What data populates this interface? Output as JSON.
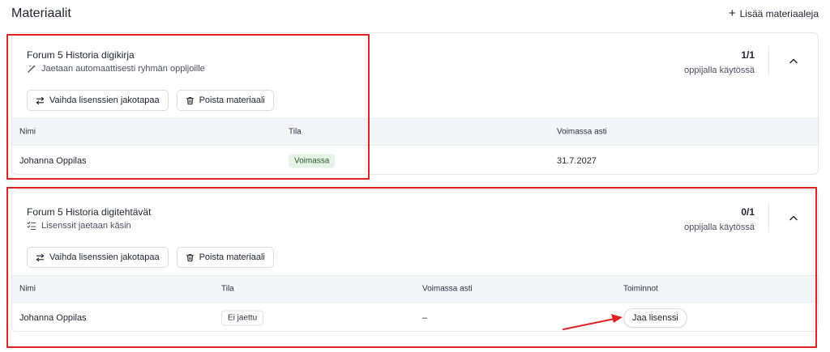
{
  "header": {
    "title": "Materiaalit",
    "add_label": "Lisää materiaaleja",
    "add_icon": "plus-icon"
  },
  "materials": [
    {
      "title": "Forum 5 Historia digikirja",
      "subtitle": "Jaetaan automaattisesti ryhmän oppijoille",
      "subtitle_icon": "magic-wand-icon",
      "count": "1/1",
      "count_label": "oppijalla käytössä",
      "buttons": {
        "change_label": "Vaihda lisenssien jakotapaa",
        "remove_label": "Poista materiaali"
      },
      "columns": [
        "Nimi",
        "Tila",
        "Voimassa asti"
      ],
      "rows": [
        {
          "name": "Johanna Oppilas",
          "status": "Voimassa",
          "valid_until": "31.7.2027"
        }
      ]
    },
    {
      "title": "Forum 5 Historia digitehtävät",
      "subtitle": "Lisenssit jaetaan käsin",
      "subtitle_icon": "checklist-icon",
      "count": "0/1",
      "count_label": "oppijalla käytössä",
      "buttons": {
        "change_label": "Vaihda lisenssien jakotapaa",
        "remove_label": "Poista materiaali"
      },
      "columns": [
        "Nimi",
        "Tila",
        "Voimassa asti",
        "Toiminnot"
      ],
      "rows": [
        {
          "name": "Johanna Oppilas",
          "status": "Ei jaettu",
          "valid_until": "–",
          "action_label": "Jaa lisenssi"
        }
      ]
    }
  ],
  "colors": {
    "highlight": "#e02424",
    "badge_active_bg": "#e5f2e6",
    "table_header_bg": "#f3f5f8"
  }
}
